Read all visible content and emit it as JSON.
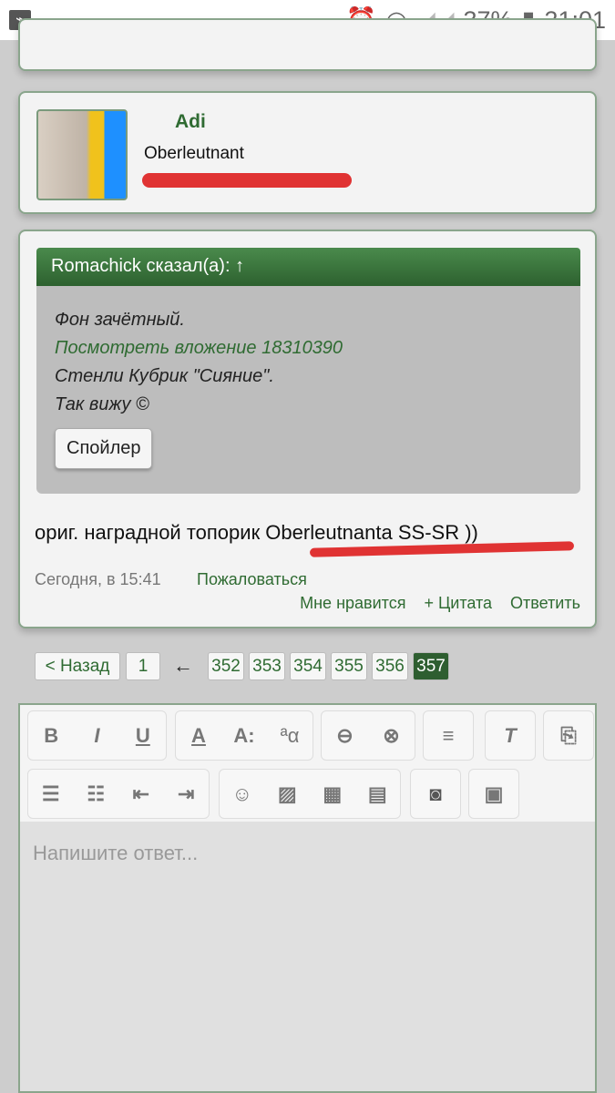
{
  "status": {
    "battery": "37%",
    "time": "21:01"
  },
  "user_card": {
    "name": "Adi",
    "rank": "Oberleutnant"
  },
  "post": {
    "quote_header": "Romachick сказал(а): ↑",
    "quote_lines": [
      "Фон зачётный.",
      "Посмотреть вложение 18310390",
      "Стенли Кубрик \"Сияние\".",
      "Так вижу ©"
    ],
    "spoiler": "Спойлер",
    "text": "ориг. наградной топорик Oberleutnanta SS-SR ))",
    "date": "Сегодня, в 15:41",
    "report": "Пожаловаться",
    "like": "Мне нравится",
    "quote": "+ Цитата",
    "reply": "Ответить"
  },
  "pagination": {
    "prev": "< Назад",
    "first": "1",
    "arrow": "←",
    "pages": [
      "352",
      "353",
      "354",
      "355",
      "356",
      "357"
    ],
    "current": "357"
  },
  "editor": {
    "placeholder": "Напишите ответ...",
    "bold": "B",
    "italic": "I",
    "underline": "U",
    "color": "A",
    "size": "A:",
    "font": "ªα"
  }
}
